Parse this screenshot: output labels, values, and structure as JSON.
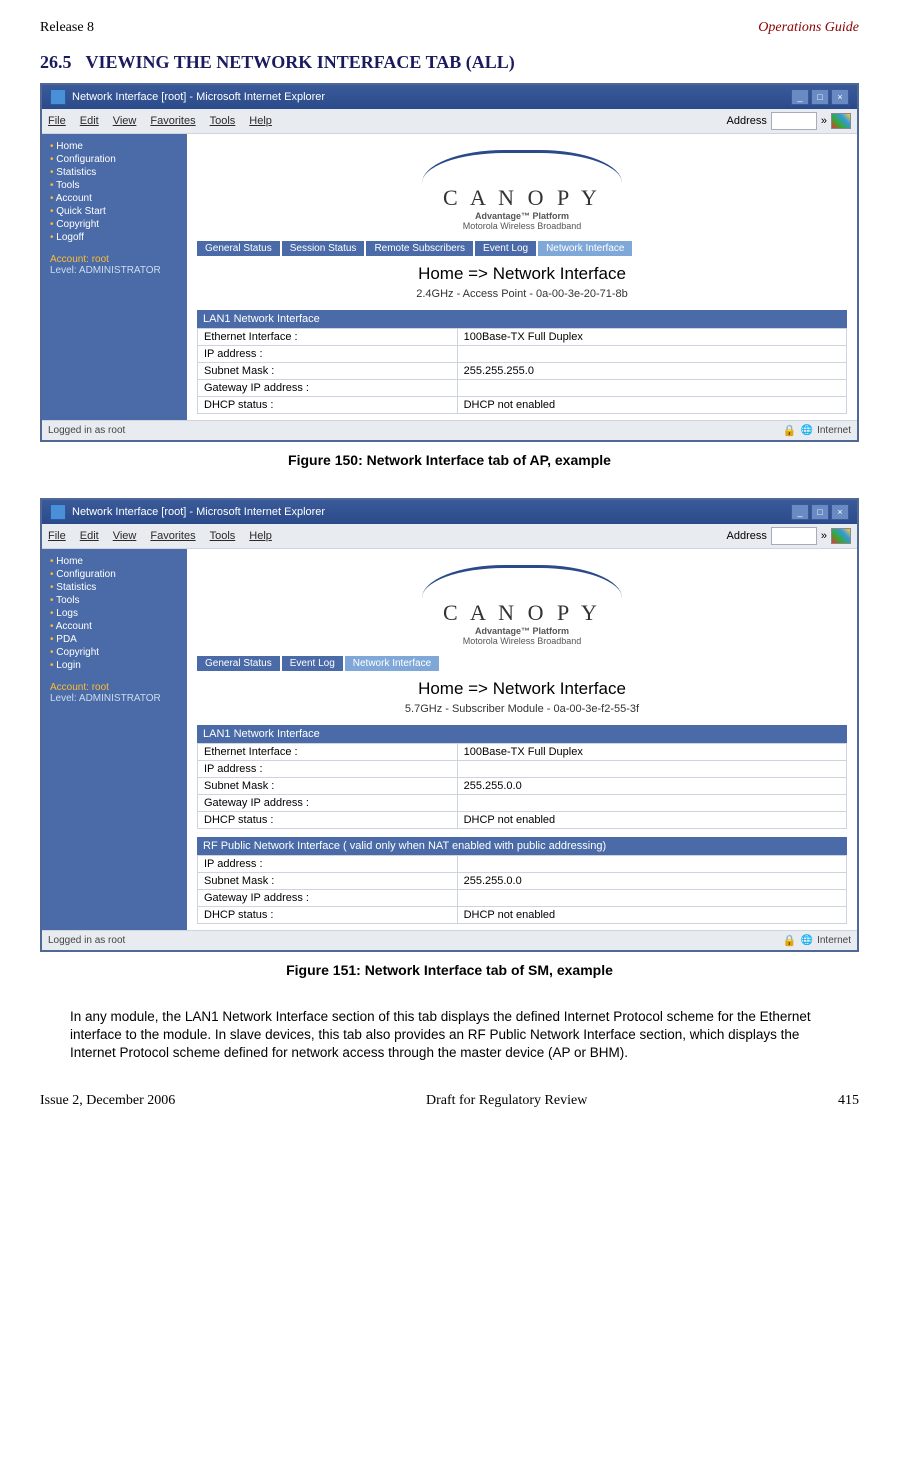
{
  "header": {
    "release": "Release 8",
    "guide": "Operations Guide"
  },
  "section": {
    "num": "26.5",
    "title": "VIEWING THE NETWORK INTERFACE TAB (ALL)"
  },
  "browser_common": {
    "title_prefix": "Network Interface [root] - Microsoft Internet Explorer",
    "menus": [
      "File",
      "Edit",
      "View",
      "Favorites",
      "Tools",
      "Help"
    ],
    "address_label": "Address",
    "status_left": "Logged in as root",
    "status_zone": "Internet",
    "logo": "C A N O P Y",
    "logo_tag": "Advantage™ Platform",
    "logo_sub": "Motorola Wireless Broadband",
    "account": "Account: root",
    "level": "Level: ADMINISTRATOR",
    "page_heading": "Home => Network Interface"
  },
  "fig1": {
    "caption": "Figure 150: Network Interface tab of AP, example",
    "sidebar": [
      "Home",
      "Configuration",
      "Statistics",
      "Tools",
      "Account",
      "Quick Start",
      "Copyright",
      "Logoff"
    ],
    "tabs": [
      "General Status",
      "Session Status",
      "Remote Subscribers",
      "Event Log",
      "Network Interface"
    ],
    "device": "2.4GHz - Access Point - 0a-00-3e-20-71-8b",
    "lan_head": "LAN1 Network Interface",
    "rows": [
      [
        "Ethernet Interface :",
        "100Base-TX Full Duplex"
      ],
      [
        "IP address :",
        ""
      ],
      [
        "Subnet Mask :",
        "255.255.255.0"
      ],
      [
        "Gateway IP address :",
        ""
      ],
      [
        "DHCP status :",
        "DHCP not enabled"
      ]
    ]
  },
  "fig2": {
    "caption": "Figure 151: Network Interface tab of SM, example",
    "sidebar": [
      "Home",
      "Configuration",
      "Statistics",
      "Tools",
      "Logs",
      "Account",
      "PDA",
      "Copyright",
      "Login"
    ],
    "tabs": [
      "General Status",
      "Event Log",
      "Network Interface"
    ],
    "device": "5.7GHz - Subscriber Module - 0a-00-3e-f2-55-3f",
    "lan_head": "LAN1 Network Interface",
    "rows": [
      [
        "Ethernet Interface :",
        "100Base-TX Full Duplex"
      ],
      [
        "IP address :",
        ""
      ],
      [
        "Subnet Mask :",
        "255.255.0.0"
      ],
      [
        "Gateway IP address :",
        ""
      ],
      [
        "DHCP status :",
        "DHCP not enabled"
      ]
    ],
    "rf_head": "RF Public Network Interface ( valid only when NAT enabled with public addressing)",
    "rf_rows": [
      [
        "IP address :",
        ""
      ],
      [
        "Subnet Mask :",
        "255.255.0.0"
      ],
      [
        "Gateway IP address :",
        ""
      ],
      [
        "DHCP status :",
        "DHCP not enabled"
      ]
    ]
  },
  "para": "In any module, the LAN1 Network Interface section of this tab displays the defined Internet Protocol scheme for the Ethernet interface to the module. In slave devices, this tab also provides an RF Public Network Interface section, which displays the Internet Protocol scheme defined for network access through the master device (AP or BHM).",
  "footer": {
    "issue": "Issue 2, December 2006",
    "mid": "Draft for Regulatory Review",
    "page": "415"
  }
}
